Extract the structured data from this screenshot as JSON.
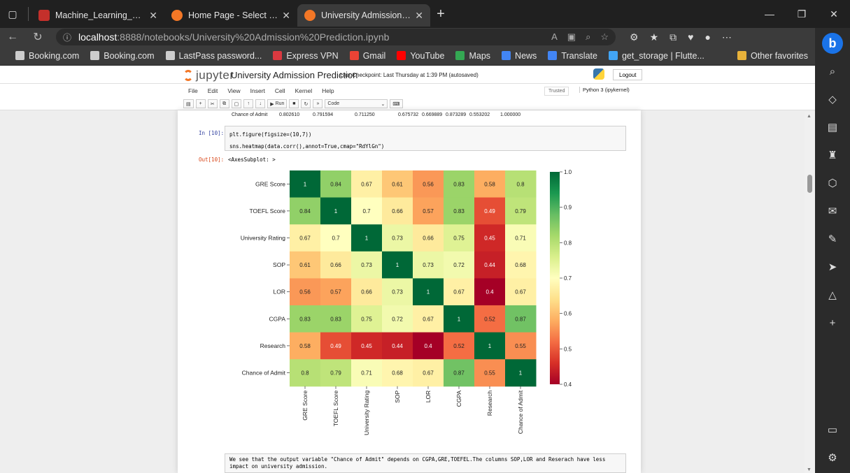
{
  "browser": {
    "tabs": [
      {
        "label": "Machine_Learning_Projects_Vide",
        "color": "#c4302b"
      },
      {
        "label": "Home Page - Select or create a n",
        "color": "#f37726"
      },
      {
        "label": "University Admission Prediction",
        "color": "#f37726"
      }
    ],
    "url_host": "localhost",
    "url_path": ":8888/notebooks/University%20Admission%20Prediction.ipynb",
    "bookmarks": [
      {
        "label": "Booking.com",
        "color": "#cccccc"
      },
      {
        "label": "Booking.com",
        "color": "#cccccc"
      },
      {
        "label": "LastPass password...",
        "color": "#cccccc"
      },
      {
        "label": "Express VPN",
        "color": "#da3940"
      },
      {
        "label": "Gmail",
        "color": "#ea4335"
      },
      {
        "label": "YouTube",
        "color": "#ff0000"
      },
      {
        "label": "Maps",
        "color": "#34a853"
      },
      {
        "label": "News",
        "color": "#4285f4"
      },
      {
        "label": "Translate",
        "color": "#4285f4"
      },
      {
        "label": "get_storage | Flutte...",
        "color": "#42a5f5"
      }
    ],
    "other_favorites": "Other favorites"
  },
  "jupyter": {
    "logo": "jupyter",
    "notebook_name": "University Admission Prediction",
    "checkpoint": "Last Checkpoint: Last Thursday at 1:39 PM  (autosaved)",
    "logout": "Logout",
    "menu": [
      "File",
      "Edit",
      "View",
      "Insert",
      "Cell",
      "Kernel",
      "Help"
    ],
    "trusted": "Trusted",
    "kernel": "Python 3 (ipykernel)",
    "run_label": "Run",
    "cell_type": "Code"
  },
  "notebook": {
    "prev_row": [
      "Chance of Admit",
      "0.802610",
      "0.791594",
      "0.711250",
      "0.675732",
      "0.669889",
      "0.873289",
      "0.553202",
      "1.000000"
    ],
    "in_prompt": "In [10]:",
    "code_line1": "plt.figure(figsize=(10,7))",
    "code_line2": "sns.heatmap(data.corr(),annot=True,cmap=\"RdYlGn\")",
    "out_prompt": "Out[10]:",
    "out_text": "<AxesSubplot: >",
    "markdown": "We see that the output variable \"Chance of Admit\" depends on CGPA,GRE,TOEFEL.The columns SOP,LOR and Reserach have less impact on university admission."
  },
  "chart_data": {
    "type": "heatmap",
    "categories": [
      "GRE Score",
      "TOEFL Score",
      "University Rating",
      "SOP",
      "LOR",
      "CGPA",
      "Research",
      "Chance of Admit"
    ],
    "matrix": [
      [
        1,
        0.84,
        0.67,
        0.61,
        0.56,
        0.83,
        0.58,
        0.8
      ],
      [
        0.84,
        1,
        0.7,
        0.66,
        0.57,
        0.83,
        0.49,
        0.79
      ],
      [
        0.67,
        0.7,
        1,
        0.73,
        0.66,
        0.75,
        0.45,
        0.71
      ],
      [
        0.61,
        0.66,
        0.73,
        1,
        0.73,
        0.72,
        0.44,
        0.68
      ],
      [
        0.56,
        0.57,
        0.66,
        0.73,
        1,
        0.67,
        0.4,
        0.67
      ],
      [
        0.83,
        0.83,
        0.75,
        0.72,
        0.67,
        1,
        0.52,
        0.87
      ],
      [
        0.58,
        0.49,
        0.45,
        0.44,
        0.4,
        0.52,
        1,
        0.55
      ],
      [
        0.8,
        0.79,
        0.71,
        0.68,
        0.67,
        0.87,
        0.55,
        1
      ]
    ],
    "colorbar_ticks": [
      0.4,
      0.5,
      0.6,
      0.7,
      0.8,
      0.9,
      1.0
    ],
    "colorbar_tick_labels": [
      "0.4",
      "0.5",
      "0.6",
      "0.7",
      "0.8",
      "0.9",
      "1.0"
    ],
    "vmin": 0.4,
    "vmax": 1.0,
    "cmap": "RdYlGn"
  }
}
